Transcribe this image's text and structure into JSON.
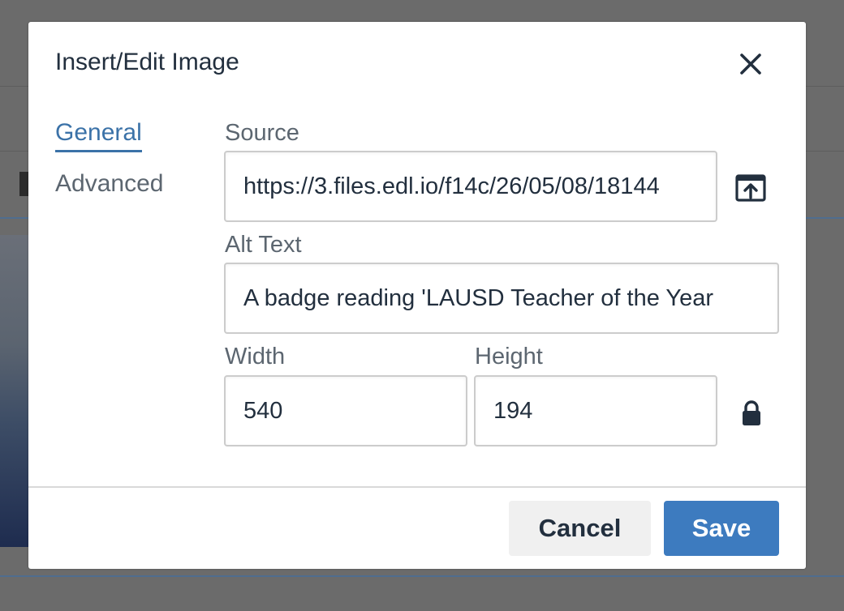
{
  "dialog": {
    "title": "Insert/Edit Image",
    "close_icon": "close-icon"
  },
  "tabs": [
    {
      "label": "General",
      "active": true
    },
    {
      "label": "Advanced",
      "active": false
    }
  ],
  "fields": {
    "source": {
      "label": "Source",
      "value": "https://3.files.edl.io/f14c/26/05/08/18144",
      "browse_icon": "browse-upload-icon"
    },
    "alt_text": {
      "label": "Alt Text",
      "value": "A badge reading 'LAUSD Teacher of the Year"
    },
    "width": {
      "label": "Width",
      "value": "540"
    },
    "height": {
      "label": "Height",
      "value": "194"
    },
    "lock_icon": "lock-icon"
  },
  "footer": {
    "cancel_label": "Cancel",
    "save_label": "Save"
  },
  "colors": {
    "accent": "#3d7bbf",
    "tab_active": "#3b72a8",
    "text": "#222f3e",
    "label": "#5c6670",
    "overlay": "#6b6b6b"
  }
}
